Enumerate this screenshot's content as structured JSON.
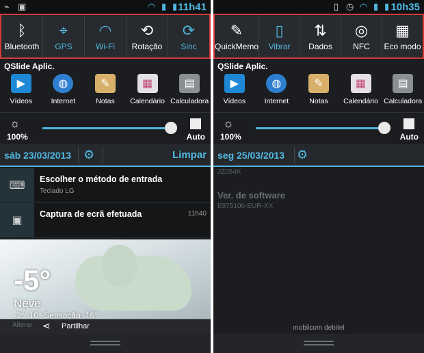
{
  "left": {
    "status": {
      "time": "11h41"
    },
    "toggles": [
      {
        "label": "Bluetooth",
        "icon": "bluetooth-icon",
        "glyph": "ᛒ",
        "active": false
      },
      {
        "label": "GPS",
        "icon": "gps-icon",
        "glyph": "⌖",
        "active": true
      },
      {
        "label": "Wi-Fi",
        "icon": "wifi-icon",
        "glyph": "◠",
        "active": true
      },
      {
        "label": "Rotação",
        "icon": "rotation-icon",
        "glyph": "⟲",
        "active": false
      },
      {
        "label": "Sinc",
        "icon": "sync-icon",
        "glyph": "⟳",
        "active": true
      }
    ],
    "date": "sáb 23/03/2013",
    "clear_label": "Limpar",
    "notifications": [
      {
        "title": "Escolher o método de entrada",
        "subtitle": "Teclado LG",
        "time": "",
        "icon": "keyboard-icon"
      },
      {
        "title": "Captura de ecrã efetuada",
        "subtitle": "",
        "time": "11h40",
        "icon": "image-icon"
      }
    ],
    "weather": {
      "temp": "-5°",
      "condition": "Neve",
      "range": "-2°/-10° Sensação -16°"
    },
    "share_ghost": "Alterar",
    "share_label": "Partilhar"
  },
  "right": {
    "status": {
      "time": "10h35"
    },
    "toggles": [
      {
        "label": "QuickMemo",
        "icon": "quickmemo-icon",
        "glyph": "✎",
        "active": false
      },
      {
        "label": "Vibrar",
        "icon": "vibrate-icon",
        "glyph": "▯",
        "active": true
      },
      {
        "label": "Dados",
        "icon": "data-icon",
        "glyph": "⇅",
        "active": false
      },
      {
        "label": "NFC",
        "icon": "nfc-icon",
        "glyph": "◎",
        "active": false
      },
      {
        "label": "Eco modo",
        "icon": "eco-mode-icon",
        "glyph": "▦",
        "active": false
      }
    ],
    "date": "seg 25/03/2013",
    "faint_top": "JZ054K",
    "software_title": "Ver. de software",
    "software_value": "E97510b-EUR-XX",
    "carrier": "mobilcom debitel"
  },
  "qslide": {
    "title": "QSlide Aplic.",
    "apps": [
      {
        "label": "Vídeos",
        "icon": "videos-icon",
        "color": "#1e88d6"
      },
      {
        "label": "Internet",
        "icon": "internet-icon",
        "color": "#2f7fd0"
      },
      {
        "label": "Notas",
        "icon": "notes-icon",
        "color": "#d8b06a"
      },
      {
        "label": "Calendário",
        "icon": "calendar-icon",
        "color": "#e5e0e6"
      },
      {
        "label": "Calculadora",
        "icon": "calculator-icon",
        "color": "#8a8f93"
      }
    ]
  },
  "brightness": {
    "percent_label": "100%",
    "level": 1.0,
    "auto_label": "Auto"
  },
  "colors": {
    "accent": "#4fb8e0",
    "highlight_border": "#d33a3a"
  }
}
